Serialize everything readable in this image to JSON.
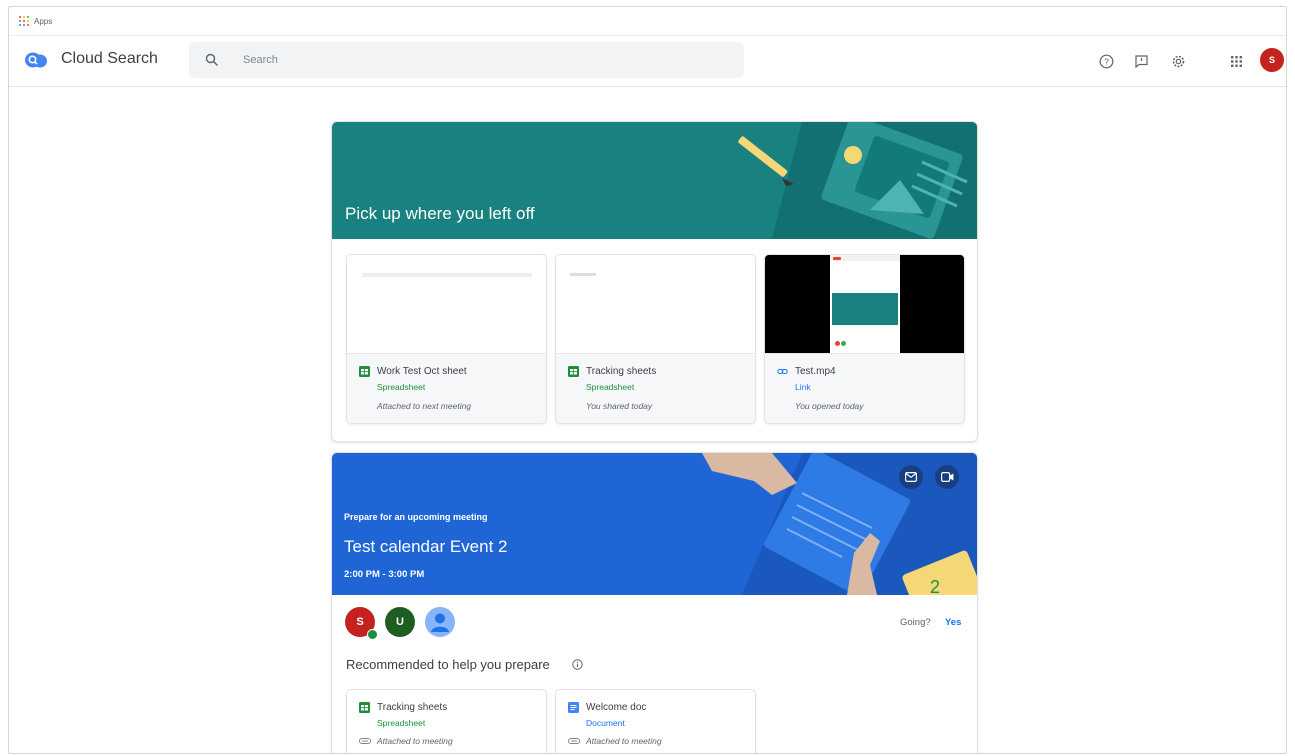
{
  "bookmarks": {
    "apps_label": "Apps"
  },
  "header": {
    "app_title": "Cloud Search",
    "search_placeholder": "Search",
    "avatar_letter": "S"
  },
  "pickup": {
    "title": "Pick up where you left off",
    "files": [
      {
        "name": "Work Test Oct sheet",
        "type": "Spreadsheet",
        "note": "Attached to next meeting",
        "icon": "sheets-icon"
      },
      {
        "name": "Tracking sheets",
        "type": "Spreadsheet",
        "note": "You shared today",
        "icon": "sheets-icon"
      },
      {
        "name": "Test.mp4",
        "type": "Link",
        "note": "You opened today",
        "icon": "link-icon"
      }
    ]
  },
  "meeting": {
    "eyebrow": "Prepare for an upcoming meeting",
    "title": "Test calendar Event 2",
    "time": "2:00 PM - 3:00 PM",
    "attendees": [
      {
        "letter": "S",
        "color": "#c5221f"
      },
      {
        "letter": "U",
        "color": "#1e6b1e"
      },
      {
        "letter": "",
        "color": "#8ab4f8"
      }
    ],
    "going_label": "Going?",
    "going_value": "Yes",
    "recommended_title": "Recommended to help you prepare",
    "recommended": [
      {
        "name": "Tracking sheets",
        "type": "Spreadsheet",
        "note": "Attached to meeting",
        "icon": "sheets-icon"
      },
      {
        "name": "Welcome doc",
        "type": "Document",
        "note": "Attached to meeting",
        "icon": "docs-icon"
      }
    ]
  },
  "colors": {
    "teal_banner": "#1a8181",
    "blue_banner": "#1f65d6",
    "accent": "#1a73e8",
    "sheets_green": "#1e8e3e"
  }
}
